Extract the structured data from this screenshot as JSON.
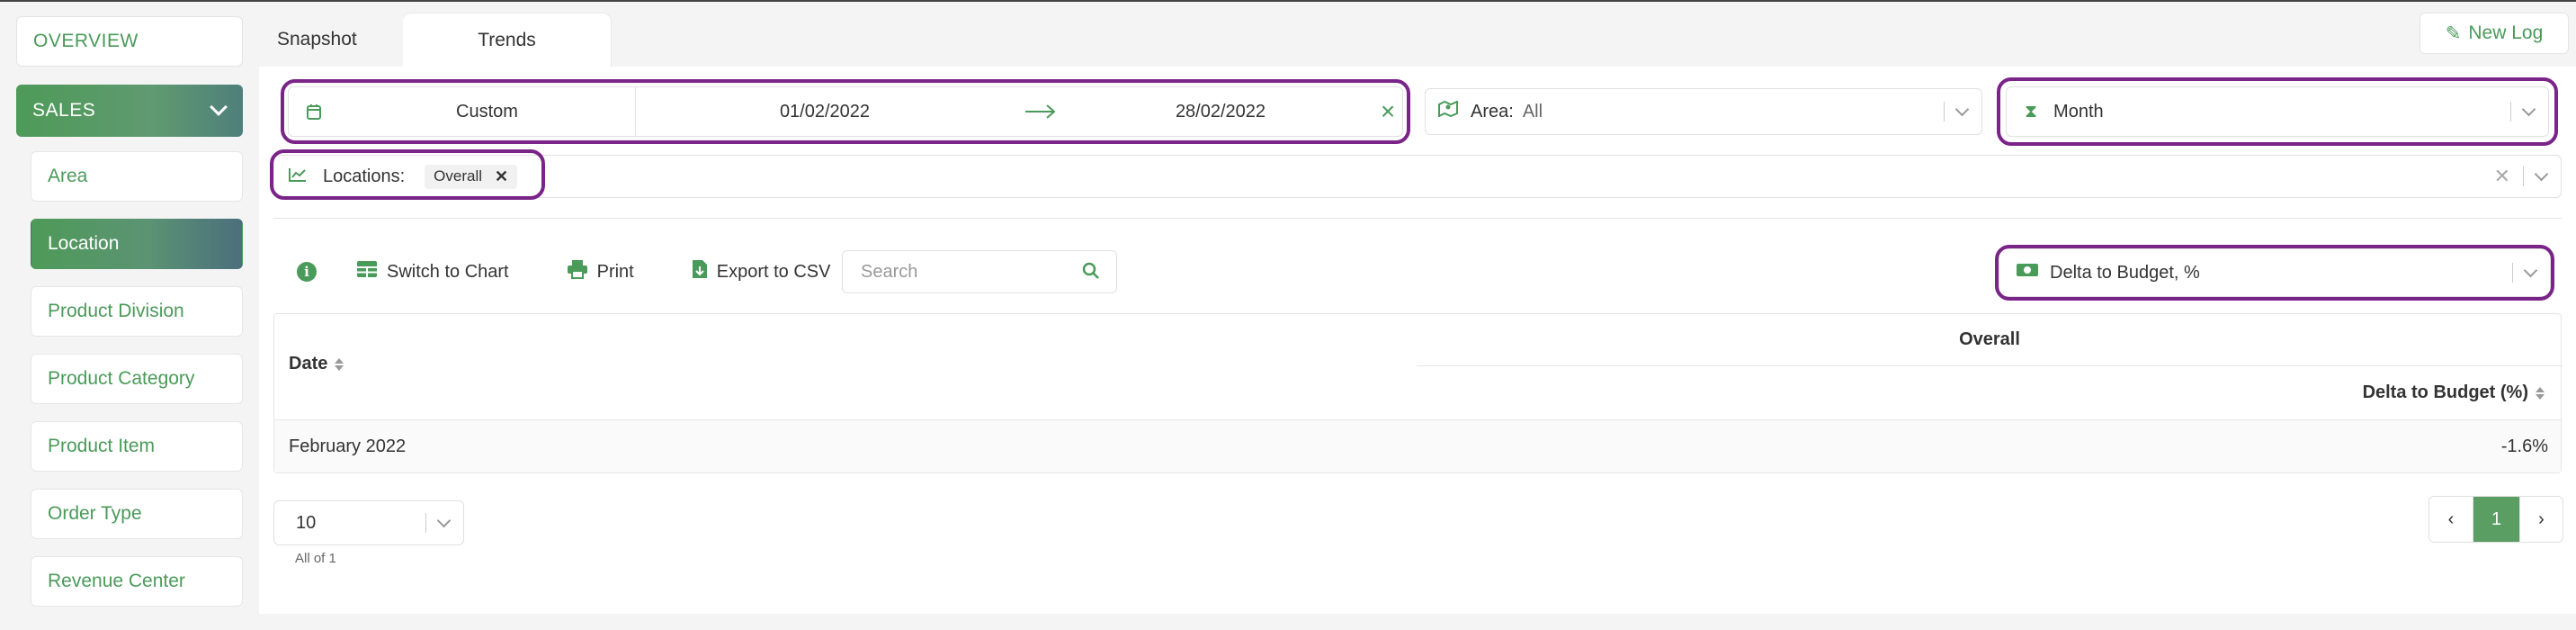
{
  "sidebar": {
    "overview": "OVERVIEW",
    "section": "SALES",
    "items": [
      {
        "label": "Area"
      },
      {
        "label": "Location"
      },
      {
        "label": "Product Division"
      },
      {
        "label": "Product Category"
      },
      {
        "label": "Product Item"
      },
      {
        "label": "Order Type"
      },
      {
        "label": "Revenue Center"
      }
    ],
    "active_item": "Location"
  },
  "tabs": {
    "snapshot": "Snapshot",
    "trends": "Trends"
  },
  "header": {
    "new_log": "New Log"
  },
  "filters": {
    "date_mode": "Custom",
    "date_from": "01/02/2022",
    "date_to": "28/02/2022",
    "area_label": "Area:",
    "area_value": "All",
    "period": "Month",
    "locations_label": "Locations:",
    "location_chip": "Overall"
  },
  "toolbar": {
    "switch_chart": "Switch to Chart",
    "print": "Print",
    "export_csv": "Export to CSV",
    "search_placeholder": "Search",
    "metric": "Delta to Budget, %"
  },
  "table": {
    "date_header": "Date",
    "group_header": "Overall",
    "col_header": "Delta to Budget (%)",
    "rows": [
      {
        "date": "February 2022",
        "value": "-1.6%"
      }
    ]
  },
  "pagination": {
    "page_size": "10",
    "all_of": "All of 1",
    "prev": "‹",
    "current": "1",
    "next": "›"
  },
  "colors": {
    "accent": "#4a9a5a",
    "highlight": "#7a2388"
  }
}
